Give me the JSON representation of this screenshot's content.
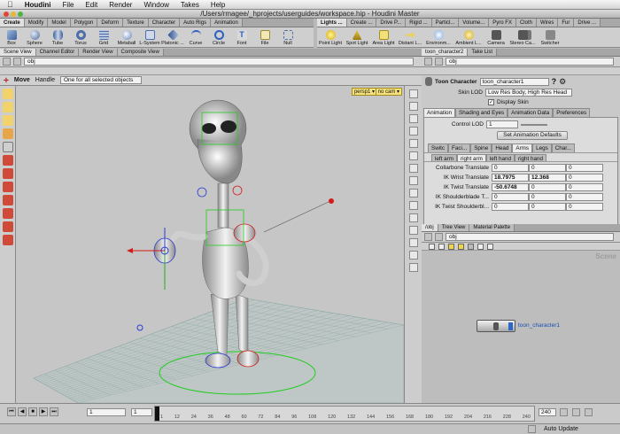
{
  "menubar": {
    "app": "Houdini",
    "items": [
      "File",
      "Edit",
      "Render",
      "Window",
      "Takes",
      "Help"
    ]
  },
  "window_title": "/Users/rmagee/_hprojects/userguides/workspace.hip - Houdini Master",
  "shelf_left": {
    "tabs": [
      "Create",
      "Modify",
      "Model",
      "Polygon",
      "Deform",
      "Texture",
      "Character",
      "Auto Rigs",
      "Animation"
    ],
    "tools": [
      "Box",
      "Sphere",
      "Tube",
      "Torus",
      "Grid",
      "Metaball",
      "L-System",
      "Platonic ...",
      "Curve",
      "Circle",
      "Font",
      "File",
      "Null"
    ]
  },
  "shelf_right": {
    "tabs": [
      "Lights ...",
      "Create ...",
      "Drive P...",
      "Rigid ...",
      "Particl...",
      "Volume...",
      "Pyro FX",
      "Cloth",
      "Wires",
      "Fur",
      "Drive ..."
    ],
    "tools": [
      "Point Light",
      "Spot Light",
      "Area Light",
      "Distant L...",
      "Environm...",
      "Ambient L...",
      "Camera",
      "Stereo Ca...",
      "Switcher"
    ]
  },
  "left_pane_tabs": [
    "Scene View",
    "Channel Editor",
    "Render View",
    "Composite View"
  ],
  "right_top_tabs": [
    "toon_character2",
    "Take List"
  ],
  "path": "obj",
  "viewport": {
    "tool": "Move",
    "handle_label": "Handle",
    "handle_mode": "One for all selected objects",
    "persp": "persp1 ▾",
    "cam": "no cam ▾"
  },
  "params": {
    "type_label": "Toon Character",
    "name": "toon_character1",
    "skin_lod_label": "Skin LOD",
    "skin_lod": "Low Res Body, High Res Head",
    "display_skin": "Display Skin",
    "tabs": [
      "Animation",
      "Shading and Eyes",
      "Animation Data",
      "Preferences"
    ],
    "control_lod_label": "Control LOD",
    "control_lod": "1",
    "set_defaults": "Set Animation Defaults",
    "part_tabs": [
      "Switc",
      "Faci...",
      "Spine",
      "Head",
      "Arms",
      "Legs",
      "Char..."
    ],
    "side_tabs": [
      "left arm",
      "right arm",
      "left hand",
      "right hand"
    ],
    "rows": [
      {
        "label": "Collarbone Translate",
        "v": [
          "0",
          "0",
          "0"
        ]
      },
      {
        "label": "IK Wrist Translate",
        "v": [
          "18.7975",
          "12.368",
          "0"
        ]
      },
      {
        "label": "IK Twist Translate",
        "v": [
          "-50.6748",
          "0",
          "0"
        ]
      },
      {
        "label": "IK Shoulderblade T...",
        "v": [
          "0",
          "0",
          "0"
        ]
      },
      {
        "label": "IK Twist Shoulderbl...",
        "v": [
          "0",
          "0",
          "0"
        ]
      }
    ]
  },
  "network_tabs": [
    "/obj",
    "Tree View",
    "Material Palette"
  ],
  "network": {
    "watermark": "Scene",
    "node": "toon_character1"
  },
  "timeline": {
    "frame": "1",
    "start": "1",
    "end": "240",
    "ticks": [
      "1",
      "12",
      "24",
      "36",
      "48",
      "60",
      "72",
      "84",
      "96",
      "108",
      "120",
      "132",
      "144",
      "156",
      "168",
      "180",
      "192",
      "204",
      "216",
      "228",
      "240"
    ]
  },
  "status": {
    "auto_update": "Auto Update"
  },
  "colors": {
    "accent": "#1a4fb5",
    "select_green": "#22cc22",
    "handle_red": "#d41a1a"
  }
}
